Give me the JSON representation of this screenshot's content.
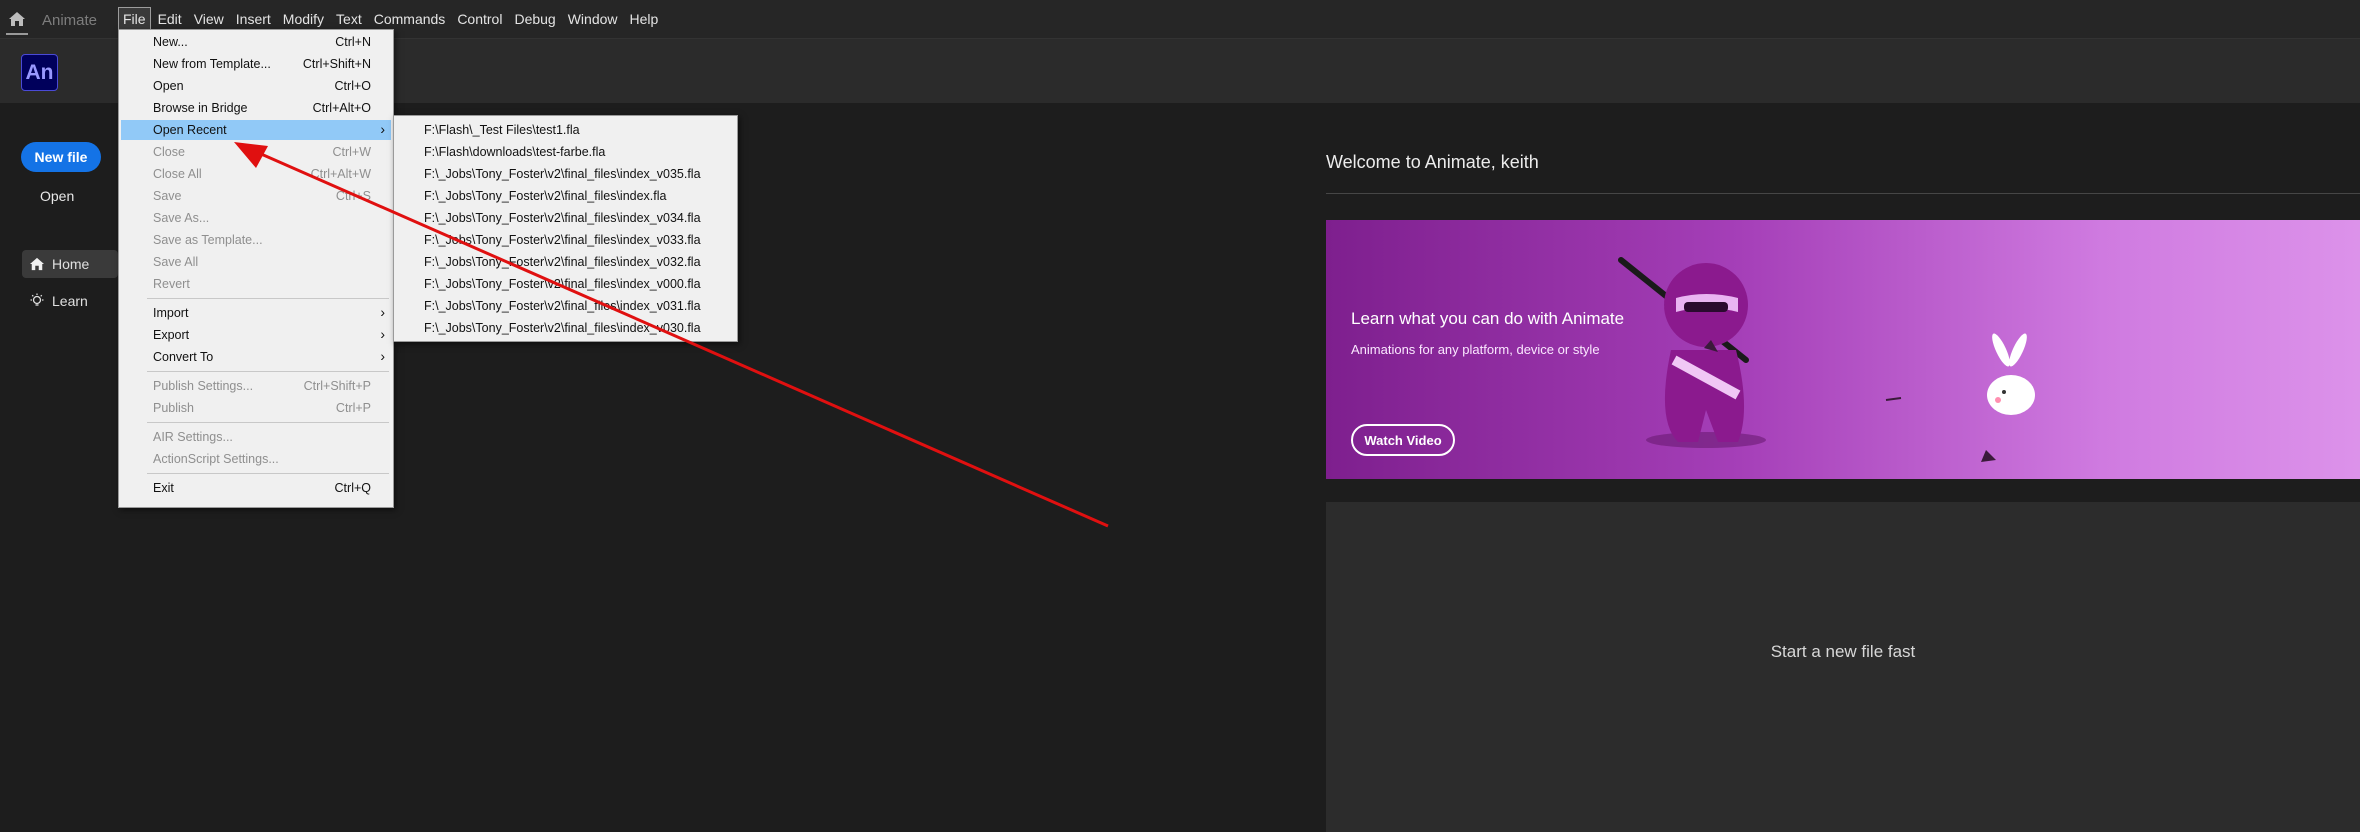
{
  "app": {
    "name": "Animate",
    "logo_text": "An"
  },
  "menubar": {
    "items": [
      "File",
      "Edit",
      "View",
      "Insert",
      "Modify",
      "Text",
      "Commands",
      "Control",
      "Debug",
      "Window",
      "Help"
    ],
    "active": "File"
  },
  "sidebar": {
    "new_file_label": "New file",
    "open_label": "Open",
    "nav": [
      {
        "label": "Home",
        "icon": "home-icon"
      },
      {
        "label": "Learn",
        "icon": "lightbulb-icon"
      }
    ]
  },
  "file_menu": {
    "items": [
      {
        "label": "New...",
        "shortcut": "Ctrl+N",
        "disabled": false
      },
      {
        "label": "New from Template...",
        "shortcut": "Ctrl+Shift+N",
        "disabled": false
      },
      {
        "label": "Open",
        "shortcut": "Ctrl+O",
        "disabled": false
      },
      {
        "label": "Browse in Bridge",
        "shortcut": "Ctrl+Alt+O",
        "disabled": false
      },
      {
        "label": "Open Recent",
        "shortcut": "",
        "submenu": true,
        "highlighted": true
      },
      {
        "label": "Close",
        "shortcut": "Ctrl+W",
        "disabled": true
      },
      {
        "label": "Close All",
        "shortcut": "Ctrl+Alt+W",
        "disabled": true
      },
      {
        "label": "Save",
        "shortcut": "Ctrl+S",
        "disabled": true
      },
      {
        "label": "Save As...",
        "shortcut": "",
        "disabled": true
      },
      {
        "label": "Save as Template...",
        "shortcut": "",
        "disabled": true
      },
      {
        "label": "Save All",
        "shortcut": "",
        "disabled": true
      },
      {
        "label": "Revert",
        "shortcut": "",
        "disabled": true
      },
      {
        "label": "Import",
        "shortcut": "",
        "submenu": true
      },
      {
        "label": "Export",
        "shortcut": "",
        "submenu": true
      },
      {
        "label": "Convert To",
        "shortcut": "",
        "submenu": true
      },
      {
        "label": "Publish Settings...",
        "shortcut": "Ctrl+Shift+P",
        "disabled": true
      },
      {
        "label": "Publish",
        "shortcut": "Ctrl+P",
        "disabled": true
      },
      {
        "label": "AIR Settings...",
        "shortcut": "",
        "disabled": true
      },
      {
        "label": "ActionScript Settings...",
        "shortcut": "",
        "disabled": true
      },
      {
        "label": "Exit",
        "shortcut": "Ctrl+Q",
        "disabled": false
      }
    ]
  },
  "open_recent": {
    "files": [
      "F:\\Flash\\_Test Files\\test1.fla",
      "F:\\Flash\\downloads\\test-farbe.fla",
      "F:\\_Jobs\\Tony_Foster\\v2\\final_files\\index_v035.fla",
      "F:\\_Jobs\\Tony_Foster\\v2\\final_files\\index.fla",
      "F:\\_Jobs\\Tony_Foster\\v2\\final_files\\index_v034.fla",
      "F:\\_Jobs\\Tony_Foster\\v2\\final_files\\index_v033.fla",
      "F:\\_Jobs\\Tony_Foster\\v2\\final_files\\index_v032.fla",
      "F:\\_Jobs\\Tony_Foster\\v2\\final_files\\index_v000.fla",
      "F:\\_Jobs\\Tony_Foster\\v2\\final_files\\index_v031.fla",
      "F:\\_Jobs\\Tony_Foster\\v2\\final_files\\index_v030.fla"
    ]
  },
  "main": {
    "welcome": "Welcome to Animate, keith",
    "banner": {
      "title": "Learn what you can do with Animate",
      "subtitle": "Animations for any platform, device or style",
      "button": "Watch Video"
    },
    "new_file_panel": "Start a new file fast"
  },
  "colors": {
    "accent": "#1473e6",
    "banner": "#a53fb8",
    "highlight": "#91c9f7",
    "annotation_arrow": "#e01010"
  }
}
